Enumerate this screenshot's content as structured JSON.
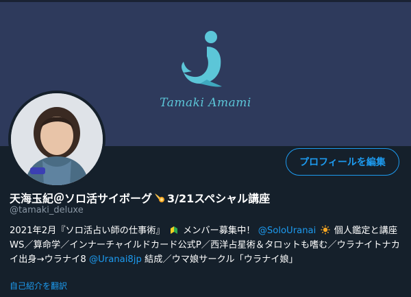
{
  "banner": {
    "logo_text": "Tamaki Amami"
  },
  "profile": {
    "edit_button": "プロフィールを編集",
    "display_name_part1": "天海玉紀＠ソロ活サイボーグ",
    "display_name_part2": "3/21スペシャル講座",
    "handle": "@tamaki_deluxe"
  },
  "bio": {
    "seg1": "2021年2月『ソロ活占い師の仕事術』",
    "seg2": "メンバー募集中！",
    "mention1": "@SoloUranai",
    "seg3": " 個人鑑定と講座WS／算命学／インナーチャイルドカード公式P／西洋占星術＆タロットも嗜む／ウラナイトナカイ出身→ウラナイ8 ",
    "mention2": "@Uranai8jp",
    "seg4": " 結成／ウマ娘サークル「ウラナイ娘」"
  },
  "translate_link": "自己紹介を翻訳",
  "colors": {
    "background": "#15202b",
    "banner": "#2e3a5c",
    "accent": "#1d9bf0",
    "logo": "#5cc6d8",
    "secondary_text": "#8b98a5"
  },
  "icons": [
    "seal-logo-icon",
    "comet-emoji-icon",
    "beginner-mark-icon",
    "sun-emoji-icon"
  ]
}
